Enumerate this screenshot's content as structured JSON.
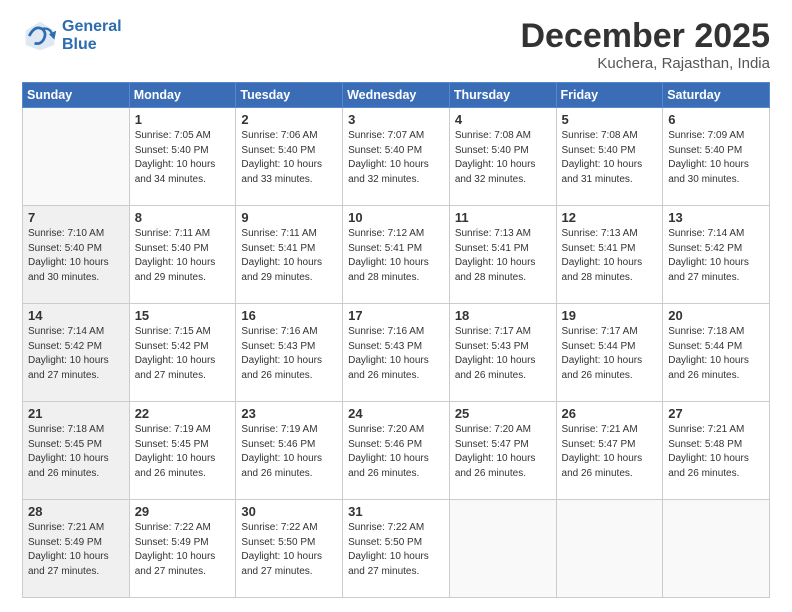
{
  "logo": {
    "line1": "General",
    "line2": "Blue"
  },
  "title": "December 2025",
  "location": "Kuchera, Rajasthan, India",
  "days_of_week": [
    "Sunday",
    "Monday",
    "Tuesday",
    "Wednesday",
    "Thursday",
    "Friday",
    "Saturday"
  ],
  "weeks": [
    [
      {
        "day": "",
        "info": "",
        "empty": true
      },
      {
        "day": "1",
        "info": "Sunrise: 7:05 AM\nSunset: 5:40 PM\nDaylight: 10 hours\nand 34 minutes."
      },
      {
        "day": "2",
        "info": "Sunrise: 7:06 AM\nSunset: 5:40 PM\nDaylight: 10 hours\nand 33 minutes."
      },
      {
        "day": "3",
        "info": "Sunrise: 7:07 AM\nSunset: 5:40 PM\nDaylight: 10 hours\nand 32 minutes."
      },
      {
        "day": "4",
        "info": "Sunrise: 7:08 AM\nSunset: 5:40 PM\nDaylight: 10 hours\nand 32 minutes."
      },
      {
        "day": "5",
        "info": "Sunrise: 7:08 AM\nSunset: 5:40 PM\nDaylight: 10 hours\nand 31 minutes."
      },
      {
        "day": "6",
        "info": "Sunrise: 7:09 AM\nSunset: 5:40 PM\nDaylight: 10 hours\nand 30 minutes."
      }
    ],
    [
      {
        "day": "7",
        "info": "Sunrise: 7:10 AM\nSunset: 5:40 PM\nDaylight: 10 hours\nand 30 minutes.",
        "shaded": true
      },
      {
        "day": "8",
        "info": "Sunrise: 7:11 AM\nSunset: 5:40 PM\nDaylight: 10 hours\nand 29 minutes."
      },
      {
        "day": "9",
        "info": "Sunrise: 7:11 AM\nSunset: 5:41 PM\nDaylight: 10 hours\nand 29 minutes."
      },
      {
        "day": "10",
        "info": "Sunrise: 7:12 AM\nSunset: 5:41 PM\nDaylight: 10 hours\nand 28 minutes."
      },
      {
        "day": "11",
        "info": "Sunrise: 7:13 AM\nSunset: 5:41 PM\nDaylight: 10 hours\nand 28 minutes."
      },
      {
        "day": "12",
        "info": "Sunrise: 7:13 AM\nSunset: 5:41 PM\nDaylight: 10 hours\nand 28 minutes."
      },
      {
        "day": "13",
        "info": "Sunrise: 7:14 AM\nSunset: 5:42 PM\nDaylight: 10 hours\nand 27 minutes."
      }
    ],
    [
      {
        "day": "14",
        "info": "Sunrise: 7:14 AM\nSunset: 5:42 PM\nDaylight: 10 hours\nand 27 minutes.",
        "shaded": true
      },
      {
        "day": "15",
        "info": "Sunrise: 7:15 AM\nSunset: 5:42 PM\nDaylight: 10 hours\nand 27 minutes."
      },
      {
        "day": "16",
        "info": "Sunrise: 7:16 AM\nSunset: 5:43 PM\nDaylight: 10 hours\nand 26 minutes."
      },
      {
        "day": "17",
        "info": "Sunrise: 7:16 AM\nSunset: 5:43 PM\nDaylight: 10 hours\nand 26 minutes."
      },
      {
        "day": "18",
        "info": "Sunrise: 7:17 AM\nSunset: 5:43 PM\nDaylight: 10 hours\nand 26 minutes."
      },
      {
        "day": "19",
        "info": "Sunrise: 7:17 AM\nSunset: 5:44 PM\nDaylight: 10 hours\nand 26 minutes."
      },
      {
        "day": "20",
        "info": "Sunrise: 7:18 AM\nSunset: 5:44 PM\nDaylight: 10 hours\nand 26 minutes."
      }
    ],
    [
      {
        "day": "21",
        "info": "Sunrise: 7:18 AM\nSunset: 5:45 PM\nDaylight: 10 hours\nand 26 minutes.",
        "shaded": true
      },
      {
        "day": "22",
        "info": "Sunrise: 7:19 AM\nSunset: 5:45 PM\nDaylight: 10 hours\nand 26 minutes."
      },
      {
        "day": "23",
        "info": "Sunrise: 7:19 AM\nSunset: 5:46 PM\nDaylight: 10 hours\nand 26 minutes."
      },
      {
        "day": "24",
        "info": "Sunrise: 7:20 AM\nSunset: 5:46 PM\nDaylight: 10 hours\nand 26 minutes."
      },
      {
        "day": "25",
        "info": "Sunrise: 7:20 AM\nSunset: 5:47 PM\nDaylight: 10 hours\nand 26 minutes."
      },
      {
        "day": "26",
        "info": "Sunrise: 7:21 AM\nSunset: 5:47 PM\nDaylight: 10 hours\nand 26 minutes."
      },
      {
        "day": "27",
        "info": "Sunrise: 7:21 AM\nSunset: 5:48 PM\nDaylight: 10 hours\nand 26 minutes."
      }
    ],
    [
      {
        "day": "28",
        "info": "Sunrise: 7:21 AM\nSunset: 5:49 PM\nDaylight: 10 hours\nand 27 minutes.",
        "shaded": true
      },
      {
        "day": "29",
        "info": "Sunrise: 7:22 AM\nSunset: 5:49 PM\nDaylight: 10 hours\nand 27 minutes."
      },
      {
        "day": "30",
        "info": "Sunrise: 7:22 AM\nSunset: 5:50 PM\nDaylight: 10 hours\nand 27 minutes."
      },
      {
        "day": "31",
        "info": "Sunrise: 7:22 AM\nSunset: 5:50 PM\nDaylight: 10 hours\nand 27 minutes."
      },
      {
        "day": "",
        "info": "",
        "empty": true
      },
      {
        "day": "",
        "info": "",
        "empty": true
      },
      {
        "day": "",
        "info": "",
        "empty": true
      }
    ]
  ]
}
